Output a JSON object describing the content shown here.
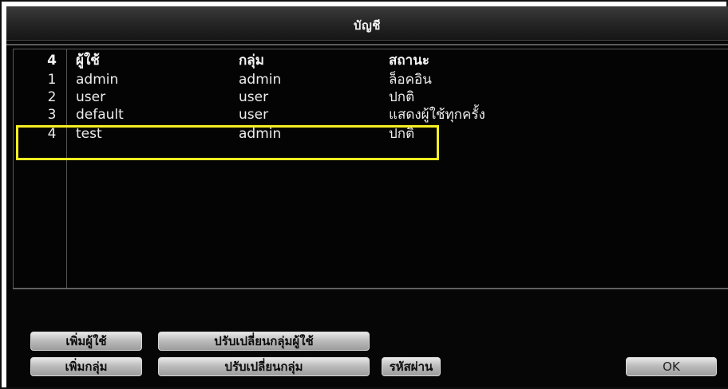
{
  "window": {
    "title": "บัญชี"
  },
  "table": {
    "header": {
      "count": "4",
      "user": "ผู้ใช้",
      "group": "กลุ่ม",
      "status": "สถานะ"
    },
    "rows": [
      {
        "index": "1",
        "user": "admin",
        "group": "admin",
        "status": "ล็อคอิน"
      },
      {
        "index": "2",
        "user": "user",
        "group": "user",
        "status": "ปกติ"
      },
      {
        "index": "3",
        "user": "default",
        "group": "user",
        "status": "แสดงผู้ใช้ทุกครั้ง"
      },
      {
        "index": "4",
        "user": "test",
        "group": "admin",
        "status": "ปกติ"
      }
    ],
    "highlighted_row_index": "4",
    "highlight_color": "#f6ee22"
  },
  "buttons": {
    "add_user": "เพิ่มผู้ใช้",
    "change_user_group": "ปรับเปลี่ยนกลุ่มผู้ใช้",
    "add_group": "เพิ่มกลุ่ม",
    "change_group": "ปรับเปลี่ยนกลุ่ม",
    "password": "รหัสผ่าน",
    "ok": "OK"
  },
  "icons": {
    "cursor": "mouse-pointer-icon"
  }
}
